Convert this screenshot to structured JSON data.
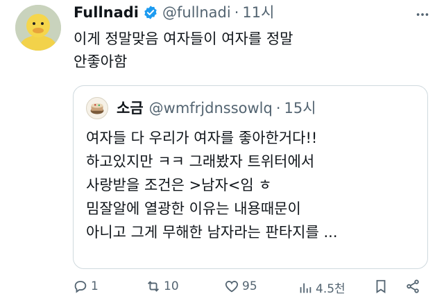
{
  "post": {
    "display_name": "Fullnadi",
    "handle": "@fullnadi",
    "separator": "·",
    "time": "11시",
    "text": "이게 정말맞음 여자들이 여자를 정말\n안좋아함"
  },
  "quoted": {
    "display_name": "소금",
    "handle": "@wmfrjdnssowlq",
    "separator": "·",
    "time": "15시",
    "text": "여자들 다 우리가 여자를 좋아한거다!!\n하고있지만 ㅋㅋ 그래봤자 트위터에서\n사랑받을 조건은 >남자<임 ㅎ\n밈잘알에 열광한 이유는 내용때문이\n아니고 그게 무해한 남자라는 판타지를 ..."
  },
  "actions": {
    "replies": "1",
    "reposts": "10",
    "likes": "95",
    "views": "4.5천"
  },
  "icons": {
    "verified": "verified-badge-icon",
    "more": "more-options-icon",
    "reply": "reply-icon",
    "repost": "repost-icon",
    "like": "heart-icon",
    "views": "views-bar-chart-icon",
    "bookmark": "bookmark-icon",
    "share": "share-icon"
  },
  "colors": {
    "text": "#0f1419",
    "secondary": "#536471",
    "verified": "#1d9bf0",
    "border": "#cfd9de"
  }
}
